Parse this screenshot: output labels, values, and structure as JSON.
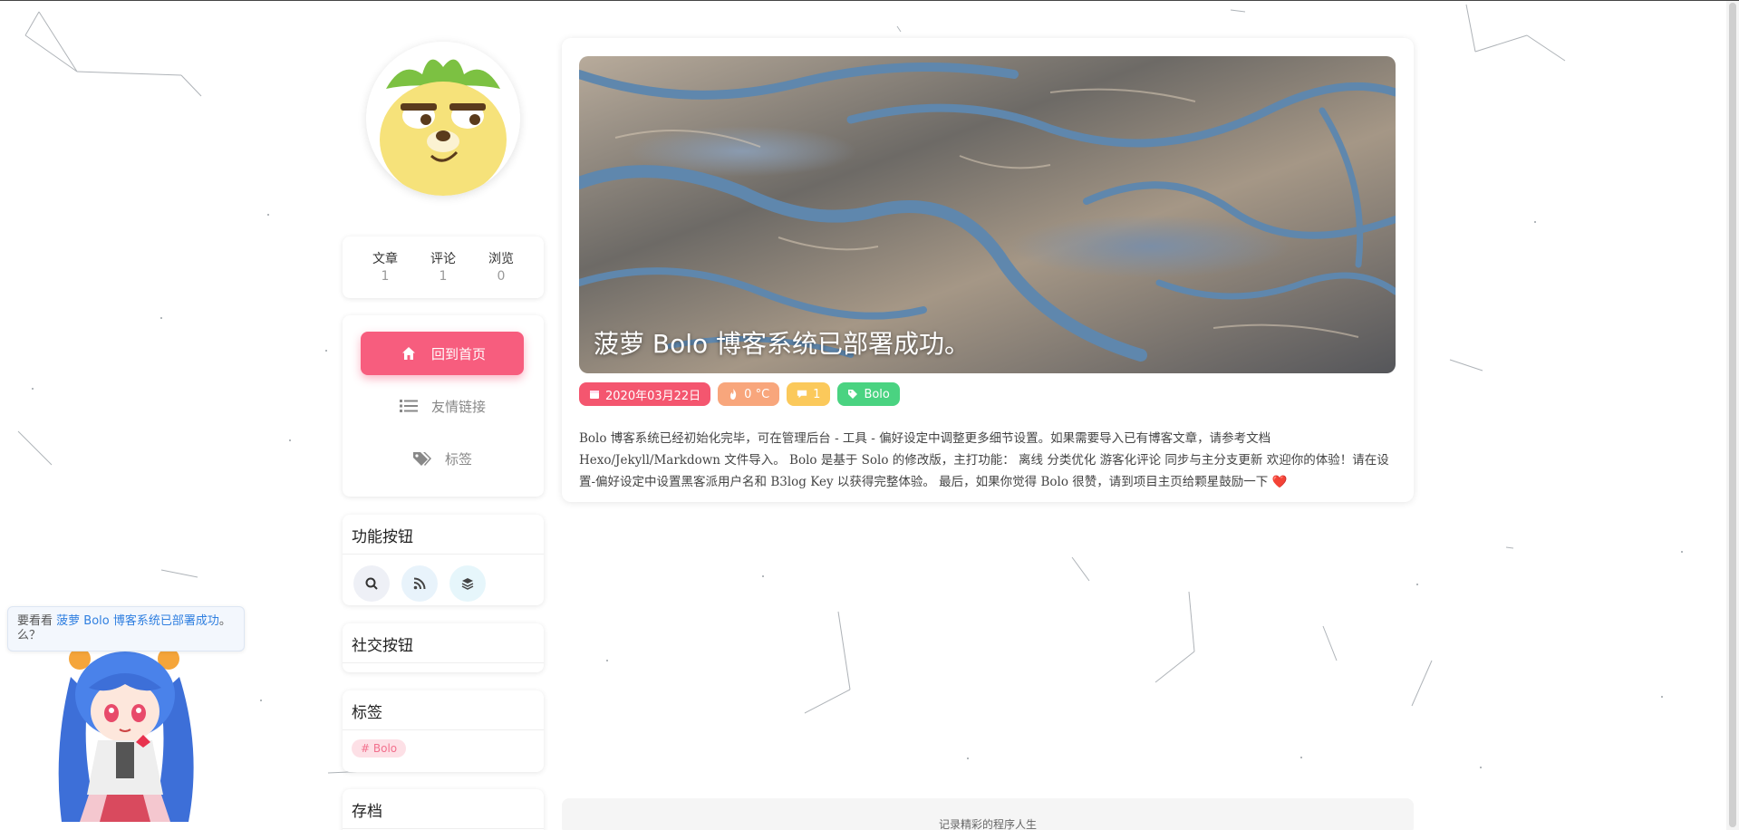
{
  "sidebar": {
    "stats": [
      {
        "label": "文章",
        "value": "1"
      },
      {
        "label": "评论",
        "value": "1"
      },
      {
        "label": "浏览",
        "value": "0"
      }
    ],
    "nav": {
      "home": "回到首页",
      "links": "友情链接",
      "tags": "标签"
    },
    "function_title": "功能按钮",
    "social_title": "社交按钮",
    "tags_title": "标签",
    "tag_item": "# Bolo",
    "archive_title": "存档"
  },
  "article": {
    "title": "菠萝 Bolo 博客系统已部署成功。",
    "date": "2020年03月22日",
    "heat": "0 °C",
    "comments": "1",
    "tag": "Bolo",
    "excerpt": "Bolo 博客系统已经初始化完毕，可在管理后台 - 工具 - 偏好设定中调整更多细节设置。如果需要导入已有博客文章，请参考文档 Hexo/Jekyll/Markdown 文件导入。 Bolo 是基于 Solo 的修改版，主打功能： 离线 分类优化 游客化评论 同步与主分支更新 欢迎你的体验！请在设置-偏好设定中设置黑客派用户名和 B3log Key 以获得完整体验。 最后，如果你觉得 Bolo 很赞，请到项目主页给颗星鼓励一下 ❤️"
  },
  "footer": {
    "text": "记录精彩的程序人生"
  },
  "mascot": {
    "prefix": "要看看 ",
    "link": "菠萝 Bolo 博客系统已部署成功",
    "suffix": "。么？"
  },
  "colors": {
    "accent_pink": "#f75d7e",
    "chip_date": "#f4566f",
    "chip_heat": "#f8a67c",
    "chip_comment": "#fbc95b",
    "chip_tag": "#4ad381"
  }
}
